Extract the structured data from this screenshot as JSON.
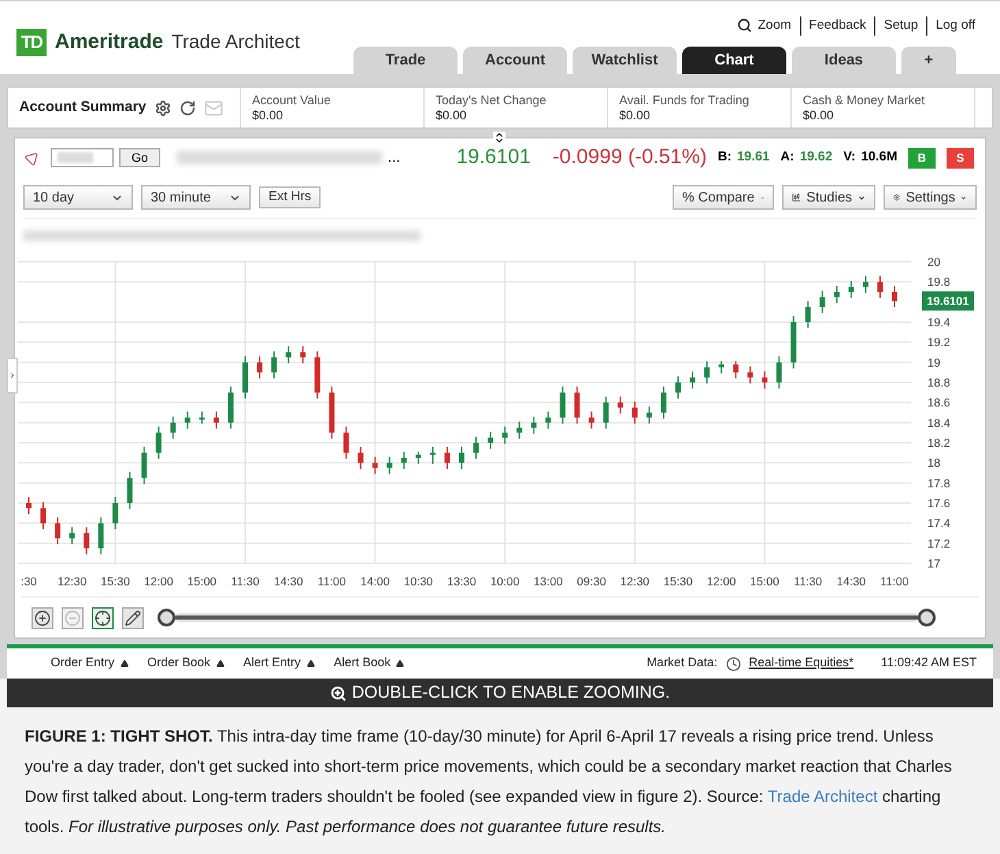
{
  "header": {
    "logo_mark": "TD",
    "brand": "Ameritrade",
    "product": "Trade Architect"
  },
  "top_links": [
    {
      "label": "Zoom",
      "kind": "zoom"
    },
    {
      "label": "Feedback",
      "kind": "link"
    },
    {
      "label": "Setup",
      "kind": "link"
    },
    {
      "label": "Log off",
      "kind": "link"
    }
  ],
  "tabs": [
    {
      "label": "Trade",
      "selected": false
    },
    {
      "label": "Account",
      "selected": false
    },
    {
      "label": "Watchlist",
      "selected": false
    },
    {
      "label": "Chart",
      "selected": true
    },
    {
      "label": "Ideas",
      "selected": false
    },
    {
      "label": "+",
      "selected": false
    }
  ],
  "account_summary": {
    "title": "Account Summary",
    "fields": [
      {
        "label": "Account Value",
        "value": "$0.00"
      },
      {
        "label": "Today's Net Change",
        "value": "$0.00"
      },
      {
        "label": "Avail. Funds for Trading",
        "value": "$0.00"
      },
      {
        "label": "Cash & Money Market",
        "value": "$0.00"
      }
    ]
  },
  "quote": {
    "go_button": "Go",
    "name_ellipsis": "...",
    "last": "19.6101",
    "change": "-0.0999 (-0.51%)",
    "bid_label": "B:",
    "bid": "19.61",
    "ask_label": "A:",
    "ask": "19.62",
    "volume_label": "V:",
    "volume": "10.6M",
    "buy_button": "B",
    "sell_button": "S"
  },
  "toolbar": {
    "period": "10 day",
    "interval": "30 minute",
    "ext_hours": "Ext Hrs",
    "compare": "% Compare",
    "studies": "Studies",
    "settings": "Settings"
  },
  "chart": {
    "price_tag": "19.6101",
    "chart_data": {
      "type": "candlestick",
      "categories": [
        ":30",
        null,
        null,
        "12:30",
        null,
        null,
        "15:30",
        null,
        null,
        "12:00",
        null,
        null,
        "15:00",
        null,
        null,
        "11:30",
        null,
        null,
        "14:30",
        null,
        null,
        "11:00",
        null,
        null,
        "14:00",
        null,
        null,
        "10:30",
        null,
        null,
        "13:30",
        null,
        null,
        "10:00",
        null,
        null,
        "13:00",
        null,
        null,
        "09:30",
        null,
        null,
        "12:30",
        null,
        null,
        "15:30",
        null,
        null,
        "12:00",
        null,
        null,
        "15:00",
        null,
        null,
        "11:30",
        null,
        null,
        "14:30",
        null,
        null,
        "11:00"
      ],
      "ohlc": [
        [
          17.6,
          17.66,
          17.49,
          17.55
        ],
        [
          17.55,
          17.61,
          17.34,
          17.4
        ],
        [
          17.4,
          17.46,
          17.19,
          17.25
        ],
        [
          17.25,
          17.36,
          17.19,
          17.3
        ],
        [
          17.3,
          17.36,
          17.09,
          17.15
        ],
        [
          17.15,
          17.46,
          17.09,
          17.4
        ],
        [
          17.4,
          17.66,
          17.34,
          17.6
        ],
        [
          17.6,
          17.91,
          17.54,
          17.85
        ],
        [
          17.85,
          18.16,
          17.79,
          18.1
        ],
        [
          18.1,
          18.36,
          18.04,
          18.3
        ],
        [
          18.3,
          18.46,
          18.24,
          18.4
        ],
        [
          18.4,
          18.51,
          18.34,
          18.45
        ],
        [
          18.45,
          18.51,
          18.39,
          18.45
        ],
        [
          18.45,
          18.51,
          18.34,
          18.4
        ],
        [
          18.4,
          18.76,
          18.34,
          18.7
        ],
        [
          18.7,
          19.06,
          18.64,
          19.0
        ],
        [
          19.0,
          19.06,
          18.84,
          18.9
        ],
        [
          18.9,
          19.11,
          18.84,
          19.05
        ],
        [
          19.05,
          19.16,
          18.99,
          19.1
        ],
        [
          19.1,
          19.16,
          18.99,
          19.05
        ],
        [
          19.05,
          19.11,
          18.64,
          18.7
        ],
        [
          18.7,
          18.76,
          18.24,
          18.3
        ],
        [
          18.3,
          18.36,
          18.04,
          18.1
        ],
        [
          18.1,
          18.16,
          17.94,
          18.0
        ],
        [
          18.0,
          18.06,
          17.89,
          17.95
        ],
        [
          17.95,
          18.06,
          17.89,
          18.0
        ],
        [
          18.0,
          18.11,
          17.94,
          18.05
        ],
        [
          18.05,
          18.11,
          17.99,
          18.08
        ],
        [
          18.08,
          18.16,
          17.99,
          18.1
        ],
        [
          18.1,
          18.16,
          17.94,
          18.0
        ],
        [
          18.0,
          18.16,
          17.94,
          18.1
        ],
        [
          18.1,
          18.26,
          18.04,
          18.2
        ],
        [
          18.2,
          18.31,
          18.14,
          18.25
        ],
        [
          18.25,
          18.36,
          18.19,
          18.3
        ],
        [
          18.3,
          18.41,
          18.24,
          18.35
        ],
        [
          18.35,
          18.46,
          18.29,
          18.4
        ],
        [
          18.4,
          18.51,
          18.34,
          18.45
        ],
        [
          18.45,
          18.76,
          18.39,
          18.7
        ],
        [
          18.7,
          18.76,
          18.39,
          18.45
        ],
        [
          18.45,
          18.51,
          18.34,
          18.4
        ],
        [
          18.4,
          18.66,
          18.34,
          18.6
        ],
        [
          18.6,
          18.66,
          18.49,
          18.55
        ],
        [
          18.55,
          18.61,
          18.39,
          18.45
        ],
        [
          18.45,
          18.56,
          18.39,
          18.5
        ],
        [
          18.5,
          18.76,
          18.44,
          18.7
        ],
        [
          18.7,
          18.86,
          18.64,
          18.8
        ],
        [
          18.8,
          18.91,
          18.74,
          18.85
        ],
        [
          18.85,
          19.01,
          18.79,
          18.95
        ],
        [
          18.95,
          19.01,
          18.89,
          18.98
        ],
        [
          18.98,
          19.01,
          18.84,
          18.9
        ],
        [
          18.9,
          18.96,
          18.79,
          18.85
        ],
        [
          18.85,
          18.91,
          18.74,
          18.8
        ],
        [
          18.8,
          19.06,
          18.74,
          19.0
        ],
        [
          19.0,
          19.46,
          18.94,
          19.4
        ],
        [
          19.4,
          19.61,
          19.34,
          19.55
        ],
        [
          19.55,
          19.71,
          19.49,
          19.65
        ],
        [
          19.65,
          19.76,
          19.59,
          19.7
        ],
        [
          19.7,
          19.81,
          19.64,
          19.75
        ],
        [
          19.75,
          19.86,
          19.69,
          19.8
        ],
        [
          19.8,
          19.86,
          19.64,
          19.7
        ],
        [
          19.7,
          19.76,
          19.55,
          19.61
        ]
      ],
      "ylim": [
        17,
        20
      ],
      "grid": true,
      "yticks": [
        {
          "value": 17,
          "label": "17"
        },
        {
          "value": 17.2,
          "label": "17.2"
        },
        {
          "value": 17.4,
          "label": "17.4"
        },
        {
          "value": 17.6,
          "label": "17.6"
        },
        {
          "value": 17.8,
          "label": "17.8"
        },
        {
          "value": 18,
          "label": "18"
        },
        {
          "value": 18.2,
          "label": "18.2"
        },
        {
          "value": 18.4,
          "label": "18.4"
        },
        {
          "value": 18.6,
          "label": "18.6"
        },
        {
          "value": 18.8,
          "label": "18.8"
        },
        {
          "value": 19,
          "label": "19"
        },
        {
          "value": 19.2,
          "label": "19.2"
        },
        {
          "value": 19.4,
          "label": "19.4"
        },
        {
          "value": 19.8,
          "label": "19.8"
        },
        {
          "value": 20,
          "label": "20"
        }
      ]
    }
  },
  "range_slider": {
    "level": 1
  },
  "chart_tools": [
    {
      "kind": "zoom-in",
      "selected": false,
      "disabled": false
    },
    {
      "kind": "zoom-out",
      "selected": false,
      "disabled": true
    },
    {
      "kind": "crosshair",
      "selected": true,
      "disabled": false
    },
    {
      "kind": "draw",
      "selected": false,
      "disabled": false
    }
  ],
  "bottom_bar": {
    "panels": [
      "Order Entry",
      "Order Book",
      "Alert Entry",
      "Alert Book"
    ],
    "market_data_label": "Market Data:",
    "feed": "Real-time Equities*",
    "time": "11:09:42 AM EST"
  },
  "banner": "DOUBLE-CLICK TO ENABLE ZOOMING.",
  "caption": {
    "text_before": "**FIGURE 1: TIGHT SHOT.** This intra-day time frame (10-day/30 minute) for April 6-April 17 reveals a rising price trend. Unless you're a day trader, don't get sucked into short-term price movements, which could be a secondary market reaction that Charles Dow first talked about. Long-term traders shouldn't be fooled (see expanded view in figure 2). Source:",
    "link": "Trade Architect",
    "text_after": "charting tools. *For illustrative purposes only. Past performance does not guarantee future results.*"
  }
}
